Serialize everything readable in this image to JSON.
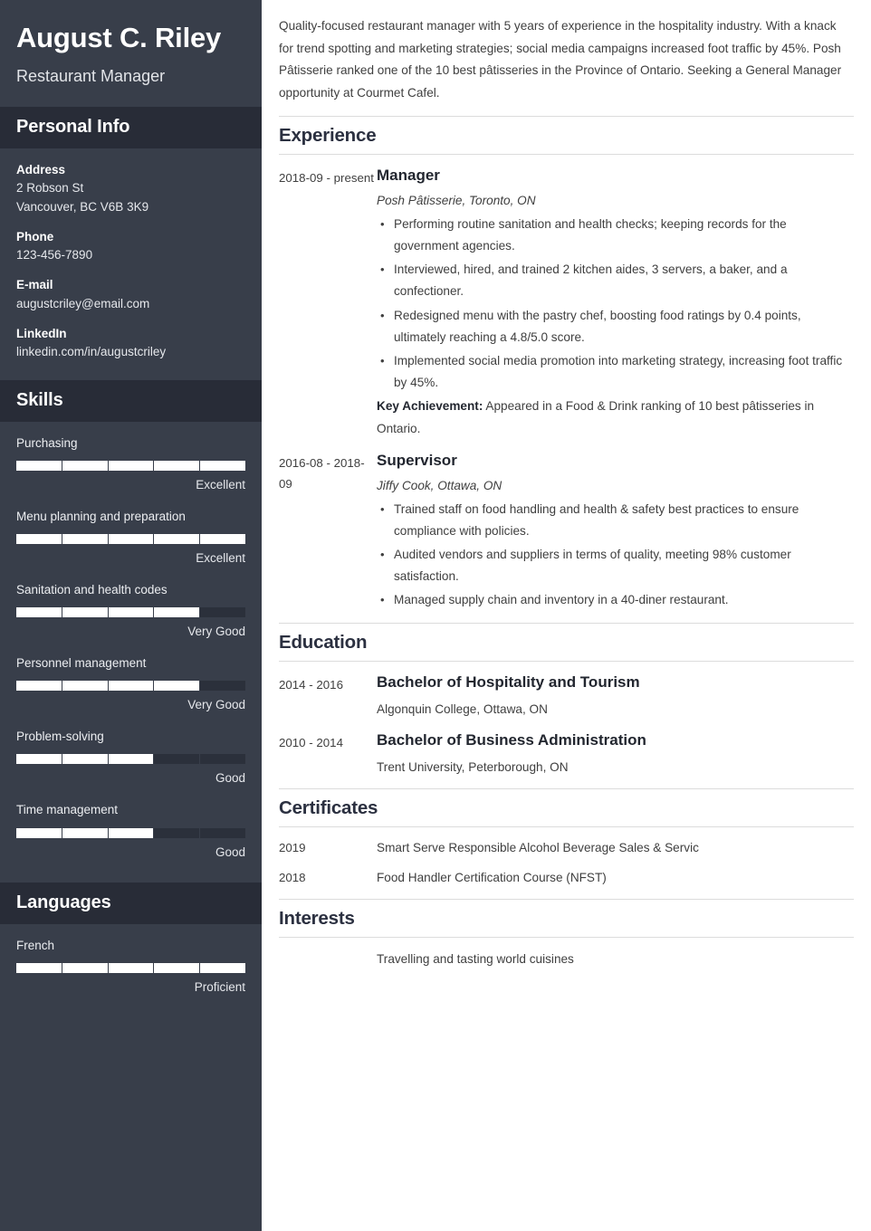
{
  "colors": {
    "sidebar_bg": "#383e4a",
    "sidebar_header_bg": "#282c37",
    "bar_fill": "#ffffff",
    "bar_track": "#2b303b",
    "heading": "#2b3040",
    "rule": "#dcdcdc"
  },
  "sidebar": {
    "name": "August C. Riley",
    "job_title": "Restaurant Manager",
    "personal_info": {
      "heading": "Personal Info",
      "items": [
        {
          "label": "Address",
          "lines": [
            "2 Robson St",
            "Vancouver, BC V6B 3K9"
          ]
        },
        {
          "label": "Phone",
          "lines": [
            "123-456-7890"
          ]
        },
        {
          "label": "E-mail",
          "lines": [
            "augustcriley@email.com"
          ]
        },
        {
          "label": "LinkedIn",
          "lines": [
            "linkedin.com/in/augustcriley"
          ]
        }
      ]
    },
    "skills": {
      "heading": "Skills",
      "segments": 5,
      "items": [
        {
          "name": "Purchasing",
          "level_label": "Excellent",
          "filled": 5
        },
        {
          "name": "Menu planning and preparation",
          "level_label": "Excellent",
          "filled": 5
        },
        {
          "name": "Sanitation and health codes",
          "level_label": "Very Good",
          "filled": 4
        },
        {
          "name": "Personnel management",
          "level_label": "Very Good",
          "filled": 4
        },
        {
          "name": "Problem-solving",
          "level_label": "Good",
          "filled": 3
        },
        {
          "name": "Time management",
          "level_label": "Good",
          "filled": 3
        }
      ]
    },
    "languages": {
      "heading": "Languages",
      "segments": 5,
      "items": [
        {
          "name": "French",
          "level_label": "Proficient",
          "filled": 5
        }
      ]
    }
  },
  "main": {
    "summary": "Quality-focused restaurant manager with 5 years of experience in the hospitality industry. With a knack for trend spotting and marketing strategies; social media campaigns increased foot traffic by 45%. Posh Pâtisserie ranked one of the 10 best pâtisseries in the Province of Ontario. Seeking a General Manager opportunity at Courmet Cafel.",
    "experience": {
      "heading": "Experience",
      "entries": [
        {
          "date": "2018-09 - present",
          "role": "Manager",
          "org": "Posh Pâtisserie, Toronto, ON",
          "bullets": [
            "Performing routine sanitation and health checks; keeping records for the government agencies.",
            "Interviewed, hired, and trained 2 kitchen aides, 3 servers, a baker, and a confectioner.",
            "Redesigned menu with the pastry chef, boosting food ratings by 0.4 points, ultimately reaching a 4.8/5.0 score.",
            "Implemented social media promotion into marketing strategy, increasing foot traffic by 45%."
          ],
          "key_achievement_label": "Key Achievement:",
          "key_achievement_text": " Appeared in a Food & Drink ranking of 10 best pâtisseries in Ontario."
        },
        {
          "date": "2016-08 - 2018-09",
          "role": "Supervisor",
          "org": "Jiffy Cook, Ottawa, ON",
          "bullets": [
            "Trained staff on food handling and health & safety best practices to ensure compliance with policies.",
            "Audited vendors and suppliers in terms of quality, meeting 98% customer satisfaction.",
            "Managed supply chain and inventory in a 40-diner restaurant."
          ],
          "key_achievement_label": "",
          "key_achievement_text": ""
        }
      ]
    },
    "education": {
      "heading": "Education",
      "entries": [
        {
          "date": "2014 - 2016",
          "degree": "Bachelor of Hospitality and Tourism",
          "school": "Algonquin College, Ottawa, ON"
        },
        {
          "date": "2010 - 2014",
          "degree": "Bachelor of Business Administration",
          "school": "Trent University, Peterborough, ON"
        }
      ]
    },
    "certificates": {
      "heading": "Certificates",
      "entries": [
        {
          "year": "2019",
          "title": "Smart Serve Responsible Alcohol Beverage Sales & Servic"
        },
        {
          "year": "2018",
          "title": "Food Handler Certification Course (NFST)"
        }
      ]
    },
    "interests": {
      "heading": "Interests",
      "entries": [
        {
          "text": "Travelling and tasting world cuisines"
        }
      ]
    }
  }
}
